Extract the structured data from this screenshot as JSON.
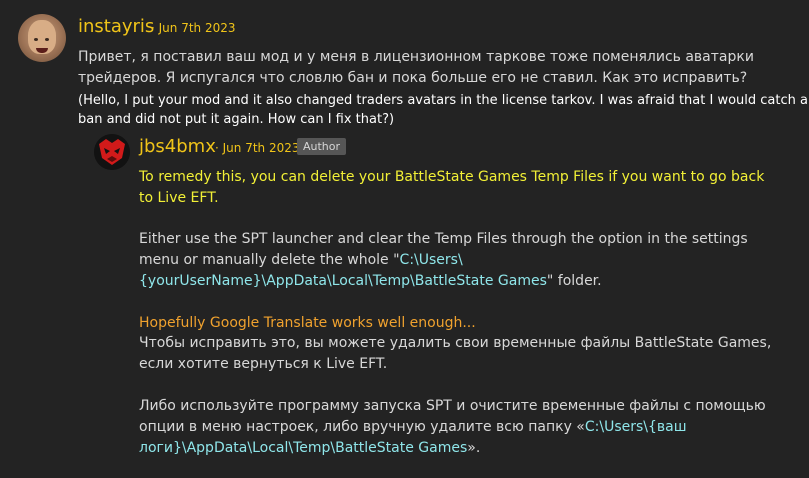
{
  "comment": {
    "username": "instayris",
    "date": "· Jun 7th 2023",
    "text_ru": "Привет, я поставил ваш мод и у меня в лицензионном таркове тоже поменялись аватарки трейдеров. Я испугался что словлю бан и пока больше его не ставил. Как это исправить?",
    "text_en": "(Hello, I put your mod and it also changed traders avatars in the license tarkov. I was afraid that I would catch a ban and did not put it again. How can I fix that?)"
  },
  "reply": {
    "username": "jbs4bmx",
    "date": "· Jun 7th 2023",
    "badge": "Author",
    "highlight": "To remedy this, you can delete your BattleState Games Temp Files if you want to go back to Live EFT.",
    "p1_prefix": "Either use the SPT launcher and clear the Temp Files through the option in the settings menu or manually delete the whole \"",
    "p1_path": "C:\\Users\\{yourUserName}\\AppData\\Local\\Temp\\BattleState Games",
    "p1_suffix": "\" folder.",
    "translate_note": "Hopefully Google Translate works well enough...",
    "ru_p1": "Чтобы исправить это, вы можете удалить свои временные файлы BattleState Games, если хотите вернуться к Live EFT.",
    "ru_p2_prefix": "Либо используйте программу запуска SPT и очистите временные файлы с помощью опции в меню настроек, либо вручную удалите всю папку «",
    "ru_p2_path": "C:\\Users\\{ваш логи}\\AppData\\Local\\Temp\\BattleState Games",
    "ru_p2_suffix": "»."
  },
  "colors": {
    "background": "#232323",
    "username": "#f0c419",
    "highlight": "#f2f036",
    "path": "#8fe6ea",
    "translate_note": "#f0a22e",
    "badge_bg": "#565656"
  }
}
